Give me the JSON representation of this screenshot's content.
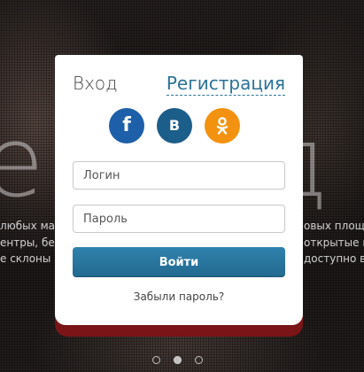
{
  "background": {
    "hero_word": "е под",
    "hero_lines": [
      {
        "left": "любых мас",
        "right": "овых площа"
      },
      {
        "left": "ентры, бег",
        "right": "открытые в"
      },
      {
        "left": "е склоны и",
        "right": "доступно в"
      }
    ]
  },
  "auth": {
    "tab_login": "Вход",
    "tab_register": "Регистрация",
    "social": {
      "facebook_label": "f",
      "vk_label": "В",
      "ok_icon": "odnoklassniki-icon"
    },
    "login_placeholder": "Логин",
    "password_placeholder": "Пароль",
    "submit_label": "Войти",
    "forgot_label": "Забыли пароль?"
  },
  "carousel": {
    "active_index": 1,
    "count": 3
  },
  "colors": {
    "accent": "#2b7297",
    "button": "#22698f",
    "facebook": "#1d5fa8",
    "vk": "#1c5e8a",
    "ok": "#f39211",
    "modal_shadow": "#7a1416"
  }
}
